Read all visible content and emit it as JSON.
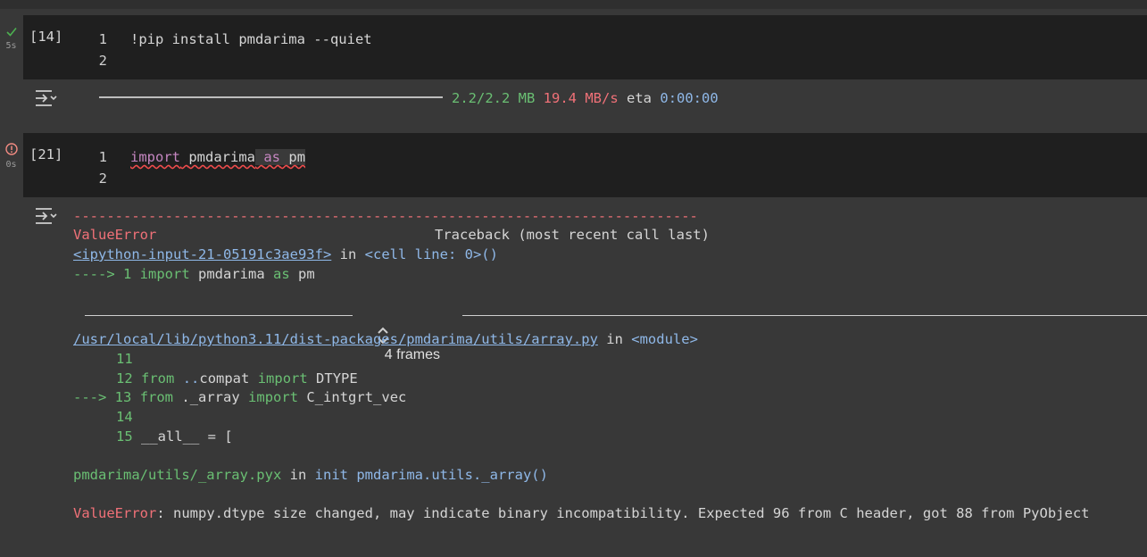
{
  "cells": [
    {
      "status_icon": "check-icon",
      "status_color": "#4caf50",
      "time": "5s",
      "exec_count": "[14]",
      "line_numbers": [
        "1",
        "2"
      ],
      "code": "!pip install pmdarima --quiet",
      "output": {
        "progress_fraction": 1.0,
        "size": "2.2/2.2 MB",
        "speed": "19.4 MB/s",
        "eta_label": "eta",
        "eta": "0:00:00"
      }
    },
    {
      "status_icon": "error-icon",
      "status_color": "#f28b82",
      "time": "0s",
      "exec_count": "[21]",
      "line_numbers": [
        "1",
        "2"
      ],
      "code_parts": {
        "kw_import": "import",
        "module": "pmdarima",
        "kw_as": "as",
        "alias": "pm"
      },
      "traceback": {
        "dashes": "---------------------------------------------------------------------------",
        "error_name": "ValueError",
        "header_right": "Traceback (most recent call last)",
        "input_link": "<ipython-input-21-05191c3ae93f>",
        "in_word": "in",
        "cell_loc": "<cell line: 0>()",
        "arrow1": "----> 1",
        "line1_import": "import",
        "line1_module": "pmdarima",
        "line1_as": "as",
        "line1_alias": "pm",
        "frames_label": "4 frames",
        "file_link": "/usr/local/lib/python3.11/dist-packages/pmdarima/utils/array.py",
        "module_loc": "<module>",
        "ctx": {
          "l11": "11",
          "l12": "12",
          "l12_from": "from",
          "l12_mod": "..",
          "l12_compat": "compat",
          "l12_import": "import",
          "l12_name": "DTYPE",
          "l13_arrow": "--->",
          "l13": "13",
          "l13_from": "from",
          "l13_mod": "._array",
          "l13_import": "import",
          "l13_name": "C_intgrt_vec",
          "l14": "14",
          "l15": "15",
          "l15_code": "__all__ = ["
        },
        "pyx_file": "pmdarima/utils/_array.pyx",
        "pyx_in": "in",
        "pyx_init": "init",
        "pyx_func": "pmdarima.utils._array()",
        "final_error": "ValueError",
        "final_message": ": numpy.dtype size changed, may indicate binary incompatibility. Expected 96 from C header, got 88 from PyObject"
      }
    }
  ]
}
